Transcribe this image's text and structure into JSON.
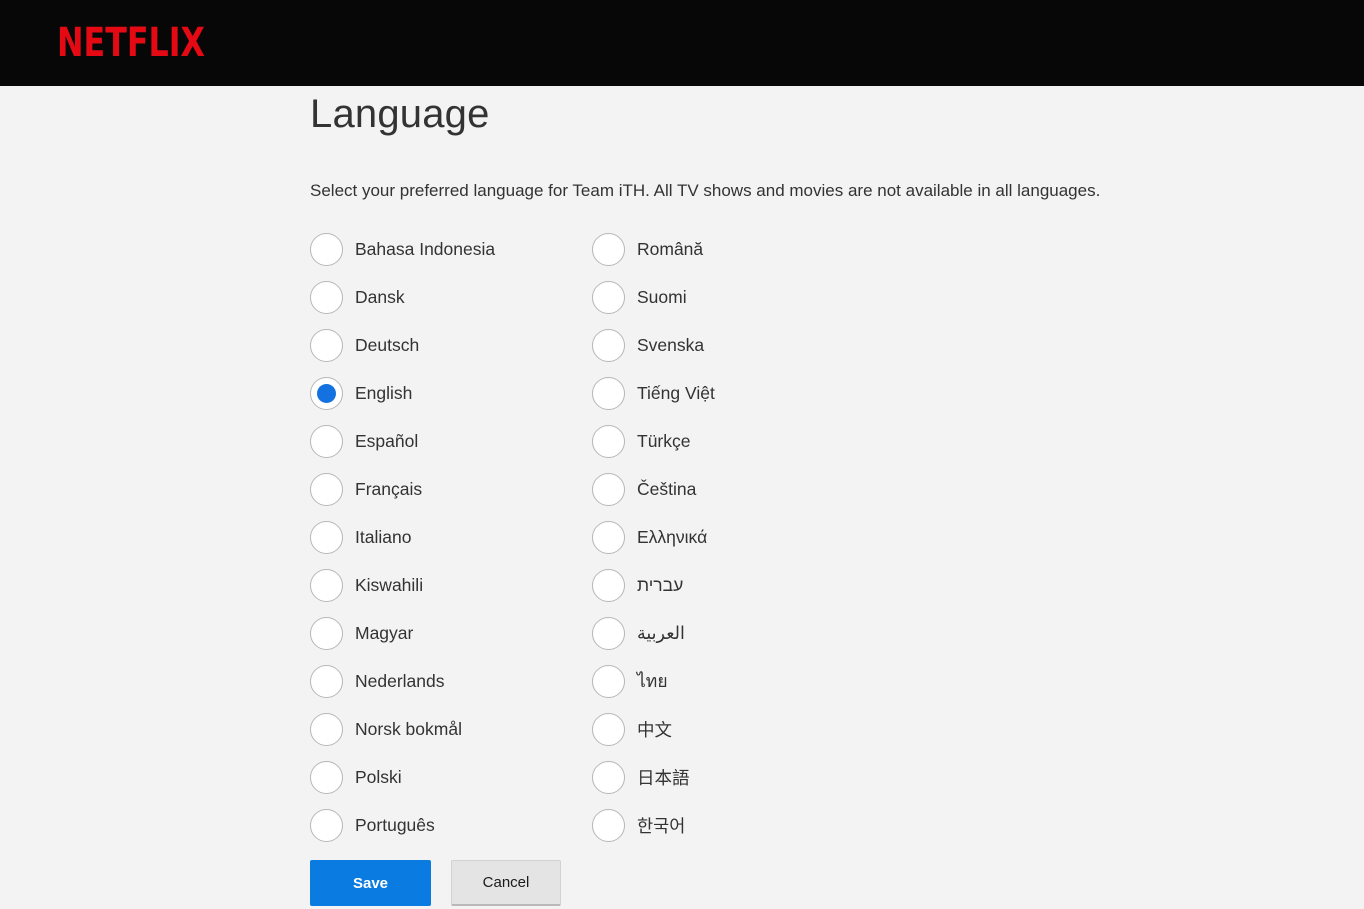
{
  "header": {
    "logo_text": "NETFLIX"
  },
  "page": {
    "title": "Language",
    "subtitle": "Select your preferred language for Team iTH. All TV shows and movies are not available in all languages."
  },
  "language_options": {
    "selected": "English",
    "left_column": [
      "Bahasa Indonesia",
      "Dansk",
      "Deutsch",
      "English",
      "Español",
      "Français",
      "Italiano",
      "Kiswahili",
      "Magyar",
      "Nederlands",
      "Norsk bokmål",
      "Polski",
      "Português"
    ],
    "right_column": [
      "Română",
      "Suomi",
      "Svenska",
      "Tiếng Việt",
      "Türkçe",
      "Čeština",
      "Ελληνικά",
      "עברית",
      "العربية",
      "ไทย",
      "中文",
      "日本語",
      "한국어"
    ]
  },
  "actions": {
    "save_label": "Save",
    "cancel_label": "Cancel"
  },
  "colors": {
    "netflix_red": "#e50914",
    "header_bg": "#070707",
    "page_bg": "#f3f3f3",
    "save_button_bg": "#0a7be0",
    "radio_selected_blue": "#1372df",
    "text": "#333333"
  }
}
